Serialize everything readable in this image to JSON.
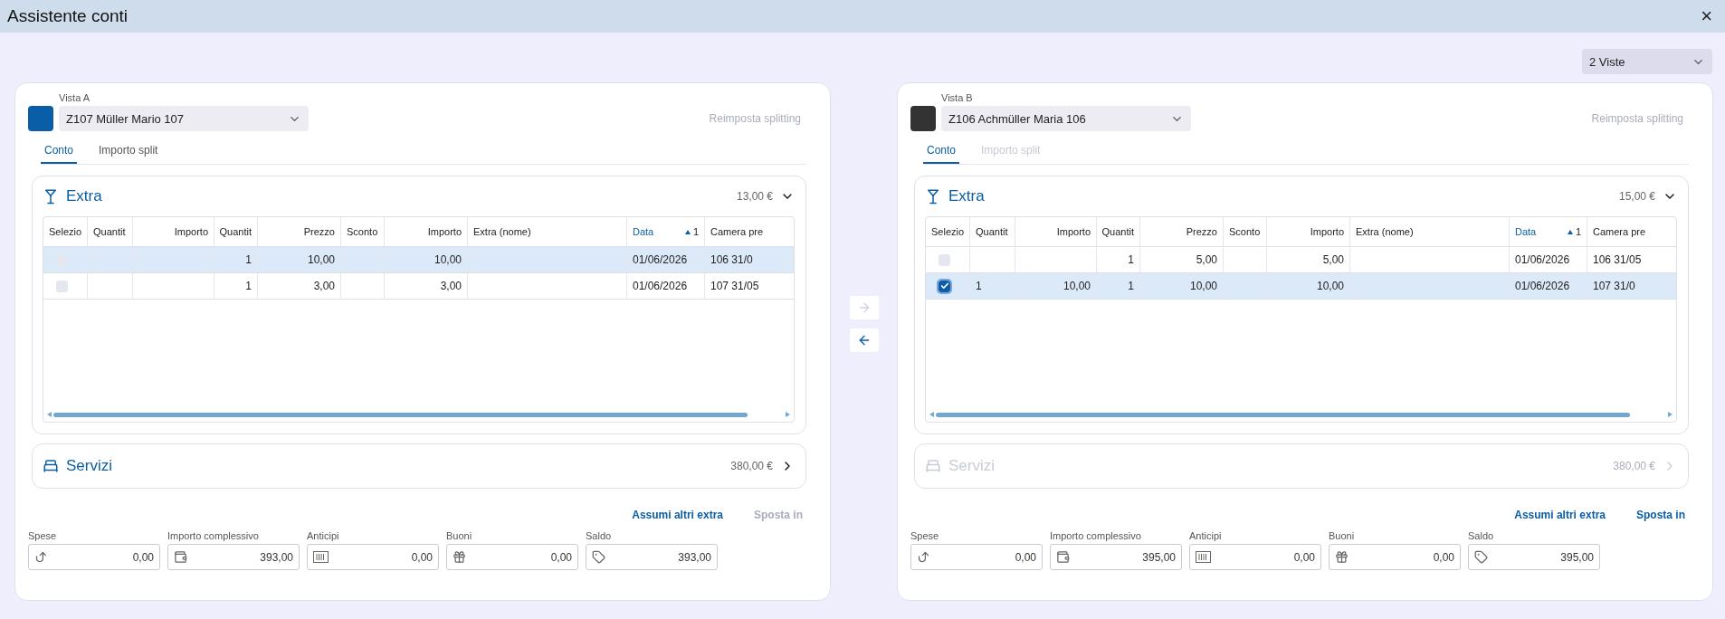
{
  "window": {
    "title": "Assistente conti",
    "close": "×"
  },
  "views_select": {
    "value": "2 Viste"
  },
  "transfer_buttons": [
    {
      "disabled": true
    },
    {
      "disabled": false
    }
  ],
  "panels": [
    {
      "label": "Vista A",
      "color": "#0a5ea8",
      "account": "Z107 Müller Mario 107",
      "reset_button": {
        "label": "Reimposta splitting",
        "disabled": true
      },
      "tabs": [
        {
          "label": "Conto",
          "selected": true,
          "disabled": false
        },
        {
          "label": "Importo split",
          "selected": false,
          "disabled": false
        }
      ],
      "extra": {
        "title": "Extra",
        "total": "13,00 €",
        "expanded": true,
        "columns": [
          {
            "label": "Selezio"
          },
          {
            "label": "Quantit"
          },
          {
            "label": "Importo"
          },
          {
            "label": "Quantit"
          },
          {
            "label": "Prezzo"
          },
          {
            "label": "Sconto"
          },
          {
            "label": "Importo"
          },
          {
            "label": "Extra (nome)"
          },
          {
            "label": "Data",
            "sort": "1"
          },
          {
            "label": "Camera pre"
          }
        ],
        "rows": [
          {
            "selected": true,
            "checked": false,
            "cells": [
              "",
              "",
              "",
              "1",
              "10,00",
              "",
              "10,00",
              "",
              "01/06/2026",
              "106  31/0"
            ]
          },
          {
            "selected": false,
            "checked": false,
            "cells": [
              "",
              "",
              "",
              "1",
              "3,00",
              "",
              "3,00",
              "",
              "01/06/2026",
              "107  31/05"
            ]
          }
        ]
      },
      "servizi": {
        "title": "Servizi",
        "total": "380,00 €",
        "expanded": false,
        "disabled": false
      },
      "actions": [
        {
          "label": "Assumi altri extra",
          "disabled": false
        },
        {
          "label": "Sposta in",
          "disabled": true
        }
      ],
      "totals": [
        {
          "label": "Spese",
          "value": "0,00"
        },
        {
          "label": "Importo complessivo",
          "value": "393,00"
        },
        {
          "label": "Anticipi",
          "value": "0,00"
        },
        {
          "label": "Buoni",
          "value": "0,00"
        },
        {
          "label": "Saldo",
          "value": "393,00"
        }
      ]
    },
    {
      "label": "Vista B",
      "color": "#333333",
      "account": "Z106 Achmüller Maria 106",
      "reset_button": {
        "label": "Reimposta splitting",
        "disabled": true
      },
      "tabs": [
        {
          "label": "Conto",
          "selected": true,
          "disabled": false
        },
        {
          "label": "Importo split",
          "selected": false,
          "disabled": true
        }
      ],
      "extra": {
        "title": "Extra",
        "total": "15,00 €",
        "expanded": true,
        "columns": [
          {
            "label": "Selezio"
          },
          {
            "label": "Quantit"
          },
          {
            "label": "Importo"
          },
          {
            "label": "Quantit"
          },
          {
            "label": "Prezzo"
          },
          {
            "label": "Sconto"
          },
          {
            "label": "Importo"
          },
          {
            "label": "Extra (nome)"
          },
          {
            "label": "Data",
            "sort": "1"
          },
          {
            "label": "Camera pre"
          }
        ],
        "rows": [
          {
            "selected": false,
            "checked": false,
            "cells": [
              "",
              "",
              "",
              "1",
              "5,00",
              "",
              "5,00",
              "",
              "01/06/2026",
              "106  31/05"
            ]
          },
          {
            "selected": true,
            "checked": true,
            "cells": [
              "",
              "1",
              "10,00",
              "1",
              "10,00",
              "",
              "10,00",
              "",
              "01/06/2026",
              "107  31/0"
            ]
          }
        ]
      },
      "servizi": {
        "title": "Servizi",
        "total": "380,00 €",
        "expanded": false,
        "disabled": true
      },
      "actions": [
        {
          "label": "Assumi altri extra",
          "disabled": false
        },
        {
          "label": "Sposta in",
          "disabled": false
        }
      ],
      "totals": [
        {
          "label": "Spese",
          "value": "0,00"
        },
        {
          "label": "Importo complessivo",
          "value": "395,00"
        },
        {
          "label": "Anticipi",
          "value": "0,00"
        },
        {
          "label": "Buoni",
          "value": "0,00"
        },
        {
          "label": "Saldo",
          "value": "395,00"
        }
      ]
    }
  ]
}
